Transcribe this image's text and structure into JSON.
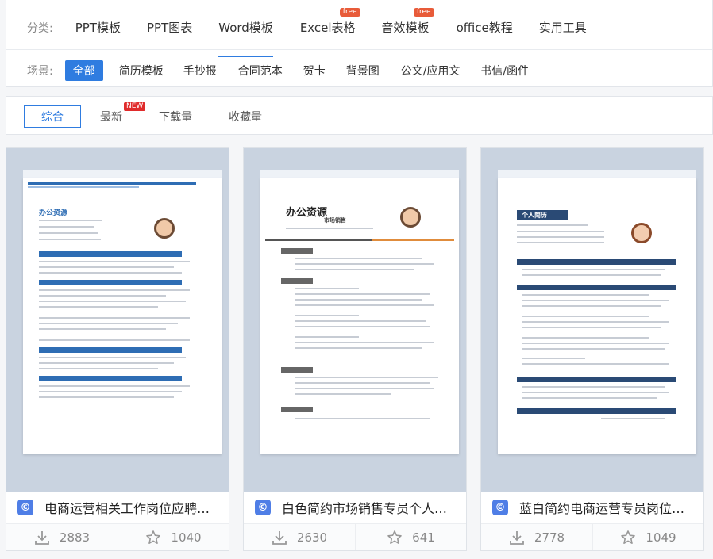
{
  "categories": {
    "label": "分类:",
    "items": [
      {
        "label": "PPT模板",
        "active": false,
        "badge": ""
      },
      {
        "label": "PPT图表",
        "active": false,
        "badge": ""
      },
      {
        "label": "Word模板",
        "active": true,
        "badge": ""
      },
      {
        "label": "Excel表格",
        "active": false,
        "badge": "free"
      },
      {
        "label": "音效模板",
        "active": false,
        "badge": "free"
      },
      {
        "label": "office教程",
        "active": false,
        "badge": ""
      },
      {
        "label": "实用工具",
        "active": false,
        "badge": ""
      }
    ]
  },
  "scenes": {
    "label": "场景:",
    "items": [
      "全部",
      "简历模板",
      "手抄报",
      "合同范本",
      "贺卡",
      "背景图",
      "公文/应用文",
      "书信/函件"
    ],
    "active_index": 0
  },
  "sort": {
    "items": [
      {
        "label": "综合",
        "active": true,
        "badge": ""
      },
      {
        "label": "最新",
        "active": false,
        "badge": "NEW"
      },
      {
        "label": "下载量",
        "active": false,
        "badge": ""
      },
      {
        "label": "收藏量",
        "active": false,
        "badge": ""
      }
    ]
  },
  "cards": [
    {
      "title": "电商运营相关工作岗位应聘个人简历",
      "downloads": "2883",
      "favorites": "1040",
      "icon": "c-icon",
      "preview": {
        "name": "办公资源",
        "subtitle": "",
        "accent": "#2e6db4"
      }
    },
    {
      "title": "白色简约市场销售专员个人简历",
      "downloads": "2630",
      "favorites": "641",
      "icon": "c-icon",
      "preview": {
        "name": "办公资源",
        "subtitle": "市场销售",
        "accent": "#555555"
      }
    },
    {
      "title": "蓝白简约电商运营专员岗位个人简历",
      "downloads": "2778",
      "favorites": "1049",
      "icon": "c-icon",
      "preview": {
        "name": "个人简历",
        "subtitle": "",
        "accent": "#2a4a75"
      }
    }
  ],
  "colors": {
    "accent": "#2f7ce0",
    "free_badge": "#e85b39",
    "new_badge": "#e02b2b"
  }
}
